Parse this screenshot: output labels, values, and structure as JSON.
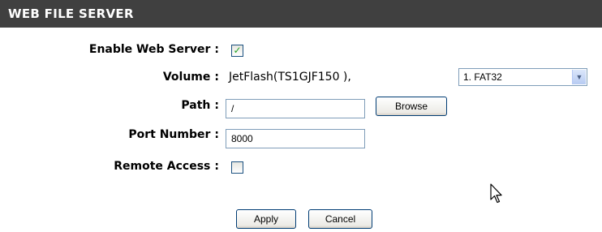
{
  "header": {
    "title": "WEB FILE SERVER"
  },
  "form": {
    "enable_web_server": {
      "label": "Enable Web Server",
      "colon": ":",
      "checked": true
    },
    "volume": {
      "label": "Volume",
      "colon": ":",
      "value": "JetFlash(TS1GJF150 ),",
      "select_value": "1. FAT32"
    },
    "path": {
      "label": "Path",
      "colon": ":",
      "value": "/",
      "browse_label": "Browse"
    },
    "port_number": {
      "label": "Port Number",
      "colon": ":",
      "value": "8000"
    },
    "remote_access": {
      "label": "Remote Access",
      "colon": ":",
      "checked": false
    }
  },
  "buttons": {
    "apply_label": "Apply",
    "cancel_label": "Cancel"
  },
  "icons": {
    "checkmark": "check-icon",
    "dropdown": "chevron-down-icon",
    "cursor": "mouse-pointer-icon"
  },
  "colors": {
    "header_bg": "#404040",
    "header_text": "#ffffff",
    "checkmark": "#21a121",
    "input_border": "#7f9db9",
    "button_border": "#003c74"
  }
}
